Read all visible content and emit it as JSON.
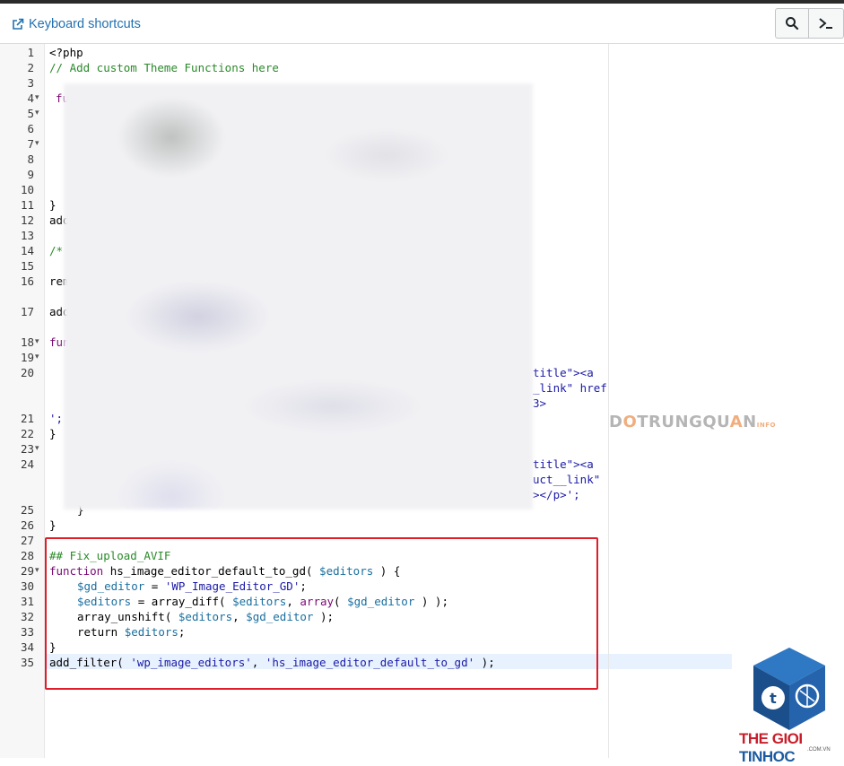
{
  "toolbar": {
    "keyboard_shortcuts_label": "Keyboard shortcuts",
    "search_icon": "search-icon",
    "terminal_icon": "terminal-prompt-icon"
  },
  "colors": {
    "link": "#2271b1",
    "comment": "#2a8a2a",
    "keyword": "#7a0874",
    "variable": "#1a6fa0",
    "string": "#1a1aa6",
    "highlight_border": "#e11d2a",
    "active_line": "#e8f2ff"
  },
  "editor": {
    "active_line": 35,
    "line_numbers": [
      "1",
      "2",
      "3",
      "4",
      "5",
      "6",
      "7",
      "8",
      "9",
      "10",
      "11",
      "12",
      "13",
      "14",
      "15",
      "16",
      "17",
      "18",
      "19",
      "20",
      "21",
      "22",
      "23",
      "24",
      "25",
      "26",
      "27",
      "28",
      "29",
      "30",
      "31",
      "32",
      "33",
      "34",
      "35"
    ],
    "visible_fragments": {
      "l1": "<?php",
      "l2": "// Add custom Theme Functions here",
      "l4": "fu",
      "l11": "}",
      "l12": "add",
      "l14": "/*",
      "l16": "rem",
      "l17": "add",
      "l18": "fun",
      "l20a": "title\"><a",
      "l20b": "_link\" href",
      "l20c": "3>",
      "l21": "';",
      "l22": "}",
      "l24a": "title\"><a",
      "l24b": "uct__link\"",
      "l24c": "></p>';",
      "l25": "}",
      "l26": "}"
    },
    "highlighted_code": {
      "l28": "## Fix_upload_AVIF",
      "l29_kw": "function",
      "l29_name": " hs_image_editor_default_to_gd( ",
      "l29_var": "$editors",
      "l29_end": " ) {",
      "l30_var": "$gd_editor",
      "l30_op": " = ",
      "l30_str": "'WP_Image_Editor_GD'",
      "l30_end": ";",
      "l31_var": "$editors",
      "l31_op": " = array_diff( ",
      "l31_var2": "$editors",
      "l31_mid": ", ",
      "l31_kw": "array",
      "l31_mid2": "( ",
      "l31_var3": "$gd_editor",
      "l31_end": " ) );",
      "l32_fn": "array_unshift( ",
      "l32_var": "$editors",
      "l32_mid": ", ",
      "l32_var2": "$gd_editor",
      "l32_end": " );",
      "l33_kw": "return ",
      "l33_var": "$editors",
      "l33_end": ";",
      "l34": "}",
      "l35_fn": "add_filter( ",
      "l35_str1": "'wp_image_editors'",
      "l35_mid": ", ",
      "l35_str2": "'hs_image_editor_default_to_gd'",
      "l35_end": " );"
    }
  },
  "watermarks": {
    "text_dark1": "D",
    "text_o": "O",
    "text_dark2": "TRUNGQU",
    "text_a": "A",
    "text_dark3": "N",
    "text_info": "INFO",
    "logo_a": "THE GIOI",
    "logo_b": " TINHOC",
    "logo_sub": ".COM.VN"
  }
}
